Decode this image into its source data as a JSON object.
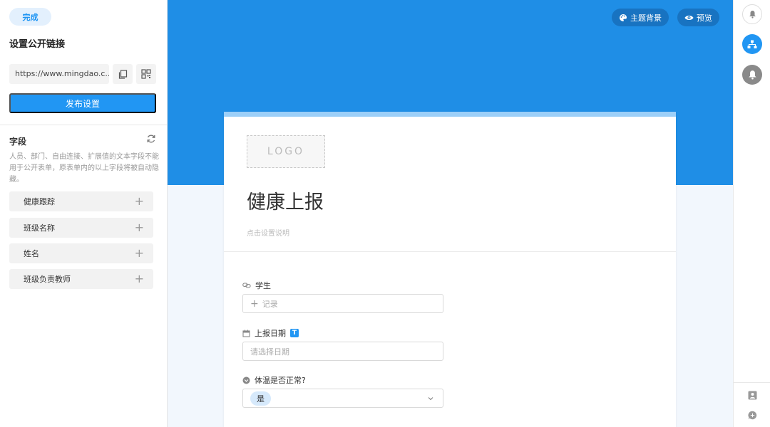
{
  "left_panel": {
    "done_label": "完成",
    "title": "设置公开链接",
    "url_value": "https://www.mingdao.c...",
    "publish_label": "发布设置",
    "fields_title": "字段",
    "fields_note": "人员、部门、自由连接、扩展值的文本字段不能用于公开表单，原表单内的以上字段将被自动隐藏。",
    "field_items": [
      {
        "label": "健康跟踪"
      },
      {
        "label": "班级名称"
      },
      {
        "label": "姓名"
      },
      {
        "label": "班级负责教师"
      }
    ]
  },
  "header": {
    "theme_label": "主题背景",
    "preview_label": "预览",
    "bg_color": "#1f8ee6"
  },
  "form": {
    "logo_text": "LOGO",
    "title": "健康上报",
    "description_placeholder": "点击设置说明",
    "questions": [
      {
        "label": "学生",
        "input_text": "记录",
        "icon": "link-icon"
      },
      {
        "label": "上报日期",
        "badge": "T",
        "placeholder": "请选择日期",
        "icon": "calendar-icon"
      },
      {
        "label": "体温是否正常?",
        "selected": "是",
        "icon": "dropdown-circle-icon"
      }
    ]
  },
  "right_rail": {
    "accent": "#2196f3"
  }
}
